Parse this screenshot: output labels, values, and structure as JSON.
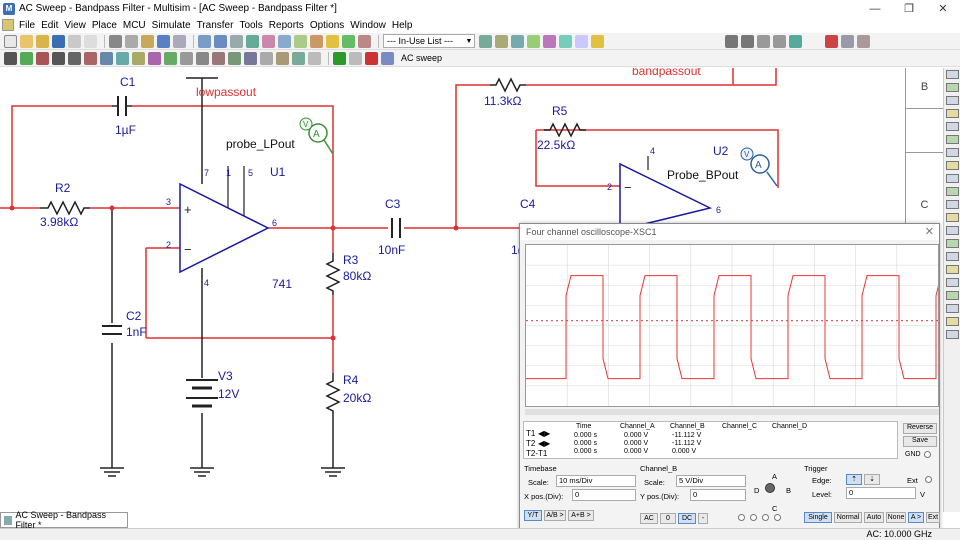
{
  "window": {
    "title": "AC Sweep - Bandpass Filter - Multisim - [AC Sweep - Bandpass Filter *]",
    "controls": [
      "minimize",
      "restore",
      "close"
    ]
  },
  "menu": [
    "File",
    "Edit",
    "View",
    "Place",
    "MCU",
    "Simulate",
    "Transfer",
    "Tools",
    "Reports",
    "Options",
    "Window",
    "Help"
  ],
  "toolbar": {
    "inuse_list": "--- In-Use List ---",
    "analysis": "AC sweep"
  },
  "schematic": {
    "components": {
      "C1": {
        "ref": "C1",
        "value": "1µF"
      },
      "R2": {
        "ref": "R2",
        "value": "3.98kΩ"
      },
      "C2": {
        "ref": "C2",
        "value": "1nF"
      },
      "U1": {
        "ref": "U1",
        "model": "741",
        "pins": [
          "7",
          "1",
          "5",
          "3",
          "2",
          "4",
          "6"
        ]
      },
      "V3": {
        "ref": "V3",
        "value": "12V"
      },
      "C3": {
        "ref": "C3",
        "value": "10nF"
      },
      "R3": {
        "ref": "R3",
        "value": "80kΩ"
      },
      "R4": {
        "ref": "R4",
        "value": "20kΩ"
      },
      "R5": {
        "ref": "R5",
        "value": "22.5kΩ"
      },
      "R6": {
        "ref": "",
        "value": "11.3kΩ"
      },
      "C4": {
        "ref": "C4",
        "value": "1("
      },
      "U2": {
        "ref": "U2",
        "pins": [
          "4",
          "2",
          "6"
        ]
      }
    },
    "nets": {
      "lowpass": "lowpassout",
      "bandpass": "bandpassout"
    },
    "probes": {
      "lp": "probe_LPout",
      "bp": "Probe_BPout",
      "symbol": "V",
      "symbol2": "A"
    },
    "sheet_border_letters": [
      "B",
      "C"
    ]
  },
  "oscilloscope": {
    "title": "Four channel oscilloscope-XSC1",
    "colors": {
      "channel_b": "#ee3333",
      "baseline": "#cc2222"
    },
    "waveform": {
      "type": "square",
      "cycles_visible": 5,
      "high_level_frac": 0.19,
      "low_level_frac": 0.83,
      "center_frac": 0.47
    },
    "readout": {
      "headers": [
        "Time",
        "Channel_A",
        "Channel_B",
        "Channel_C",
        "Channel_D"
      ],
      "rows": [
        {
          "label": "T1",
          "time": "0.000 s",
          "a": "0.000 V",
          "b": "-11.112 V"
        },
        {
          "label": "T2",
          "time": "0.000 s",
          "a": "0.000 V",
          "b": "-11.112 V"
        },
        {
          "label": "T2-T1",
          "time": "0.000 s",
          "a": "0.000 V",
          "b": "0.000 V"
        }
      ],
      "reverse": "Reverse",
      "save": "Save",
      "gnd": "GND"
    },
    "timebase": {
      "title": "Timebase",
      "scale_label": "Scale:",
      "scale": "10 ms/Div",
      "xpos_label": "X pos.(Div):",
      "xpos": "0",
      "modes": [
        "Y/T",
        "A/B >",
        "A+B >"
      ]
    },
    "channel": {
      "title": "Channel_B",
      "scale_label": "Scale:",
      "scale": "5  V/Div",
      "ypos_label": "Y pos.(Div):",
      "ypos": "0",
      "coupling": [
        "AC",
        "0",
        "DC",
        "-"
      ],
      "selectors": [
        "A",
        "B",
        "C",
        "D"
      ]
    },
    "trigger": {
      "title": "Trigger",
      "edge_label": "Edge:",
      "level_label": "Level:",
      "level": "0",
      "unit": "V",
      "ext": "Ext",
      "modes": [
        "Single",
        "Normal",
        "Auto",
        "None",
        "A >",
        "Ext"
      ]
    }
  },
  "sheet_tab": "AC Sweep - Bandpass Filter *",
  "status": "AC: 10.000 GHz"
}
